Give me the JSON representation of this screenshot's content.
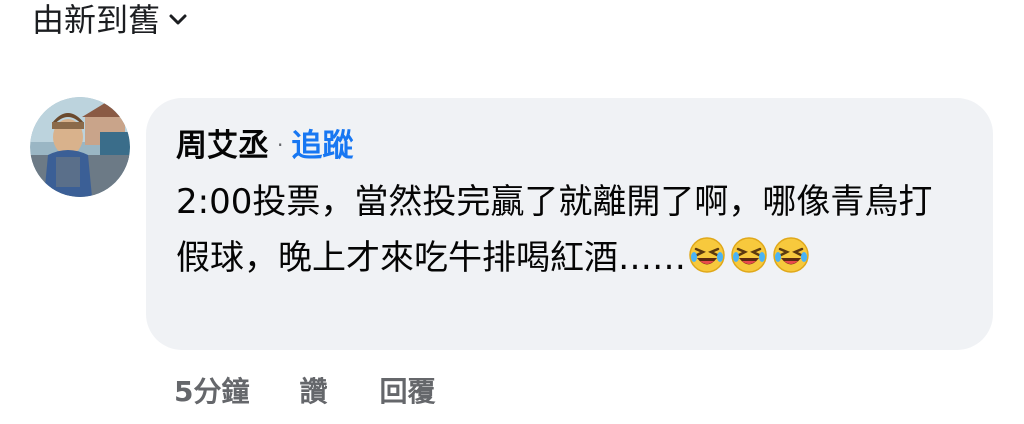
{
  "sort": {
    "label": "由新到舊",
    "icon": "chevron-down-icon"
  },
  "comment": {
    "author": "周艾丞",
    "separator": "·",
    "follow_label": "追蹤",
    "text_part1": "2:00投票，當然投完贏了就離開了啊，哪像青鳥打假球，晚上才來吃牛排喝紅酒……",
    "emoji_name": "rolling-on-floor-laughing-icon",
    "emoji_count": 3,
    "timestamp": "5分鐘",
    "like_label": "讚",
    "reply_label": "回覆"
  },
  "colors": {
    "bubble_bg": "#f0f2f5",
    "link_blue": "#1877f2",
    "meta_gray": "#65676b",
    "text": "#050505"
  }
}
